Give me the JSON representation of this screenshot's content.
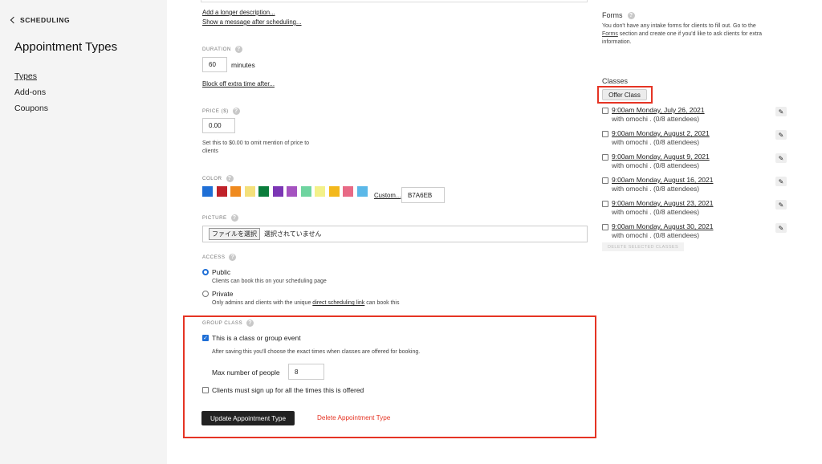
{
  "sidebar": {
    "back_label": "SCHEDULING",
    "title": "Appointment Types",
    "items": [
      {
        "label": "Types"
      },
      {
        "label": "Add-ons"
      },
      {
        "label": "Coupons"
      }
    ]
  },
  "form": {
    "longer_description_link": "Add a longer description...",
    "message_after_link": "Show a message after scheduling...",
    "duration": {
      "label": "DURATION",
      "value": "60",
      "unit": "minutes",
      "block_link": "Block off extra time after..."
    },
    "price": {
      "label": "PRICE ($)",
      "value": "0.00",
      "help": "Set this to $0.00 to omit mention of price to clients"
    },
    "color": {
      "label": "COLOR",
      "swatches": [
        "#1f6fd6",
        "#c0222a",
        "#ef8a1f",
        "#f4e07b",
        "#0b7d3c",
        "#7c36b5",
        "#a553c0",
        "#6fd4a0",
        "#f3f18a",
        "#f3b81c",
        "#e86a86",
        "#5bb8e8"
      ],
      "custom_link": "Custom...",
      "custom_value": "B7A6EB"
    },
    "picture": {
      "label": "PICTURE",
      "button": "ファイルを選択",
      "status": "選択されていません"
    },
    "access": {
      "label": "ACCESS",
      "public_label": "Public",
      "public_help": "Clients can book this on your scheduling page",
      "private_label": "Private",
      "private_help_pre": "Only admins and clients with the unique ",
      "private_help_link": "direct scheduling link",
      "private_help_post": " can book this"
    },
    "group_class": {
      "label": "GROUP CLASS",
      "checkbox_label": "This is a class or group event",
      "help": "After saving this you'll choose the exact times when classes are offered for booking.",
      "max_label": "Max number of people",
      "max_value": "8",
      "all_times_label": "Clients must sign up for all the times this is offered"
    },
    "update_button": "Update Appointment Type",
    "delete_link": "Delete Appointment Type"
  },
  "right": {
    "forms_title": "Forms",
    "forms_text_1": "You don't have any intake forms for clients to fill out. Go to the",
    "forms_link": "Forms",
    "forms_text_2": " section and create one if you'd like to ask clients for extra",
    "forms_text_3": "information.",
    "classes_title": "Classes",
    "offer_button": "Offer Class",
    "classes": [
      {
        "date": "9:00am Monday, July 26, 2021",
        "sub": "with omochi . (0/8 attendees)"
      },
      {
        "date": "9:00am Monday, August 2, 2021",
        "sub": "with omochi . (0/8 attendees)"
      },
      {
        "date": "9:00am Monday, August 9, 2021",
        "sub": "with omochi . (0/8 attendees)"
      },
      {
        "date": "9:00am Monday, August 16, 2021",
        "sub": "with omochi . (0/8 attendees)"
      },
      {
        "date": "9:00am Monday, August 23, 2021",
        "sub": "with omochi . (0/8 attendees)"
      },
      {
        "date": "9:00am Monday, August 30, 2021",
        "sub": "with omochi . (0/8 attendees)"
      }
    ],
    "delete_selected": "DELETE SELECTED CLASSES"
  }
}
